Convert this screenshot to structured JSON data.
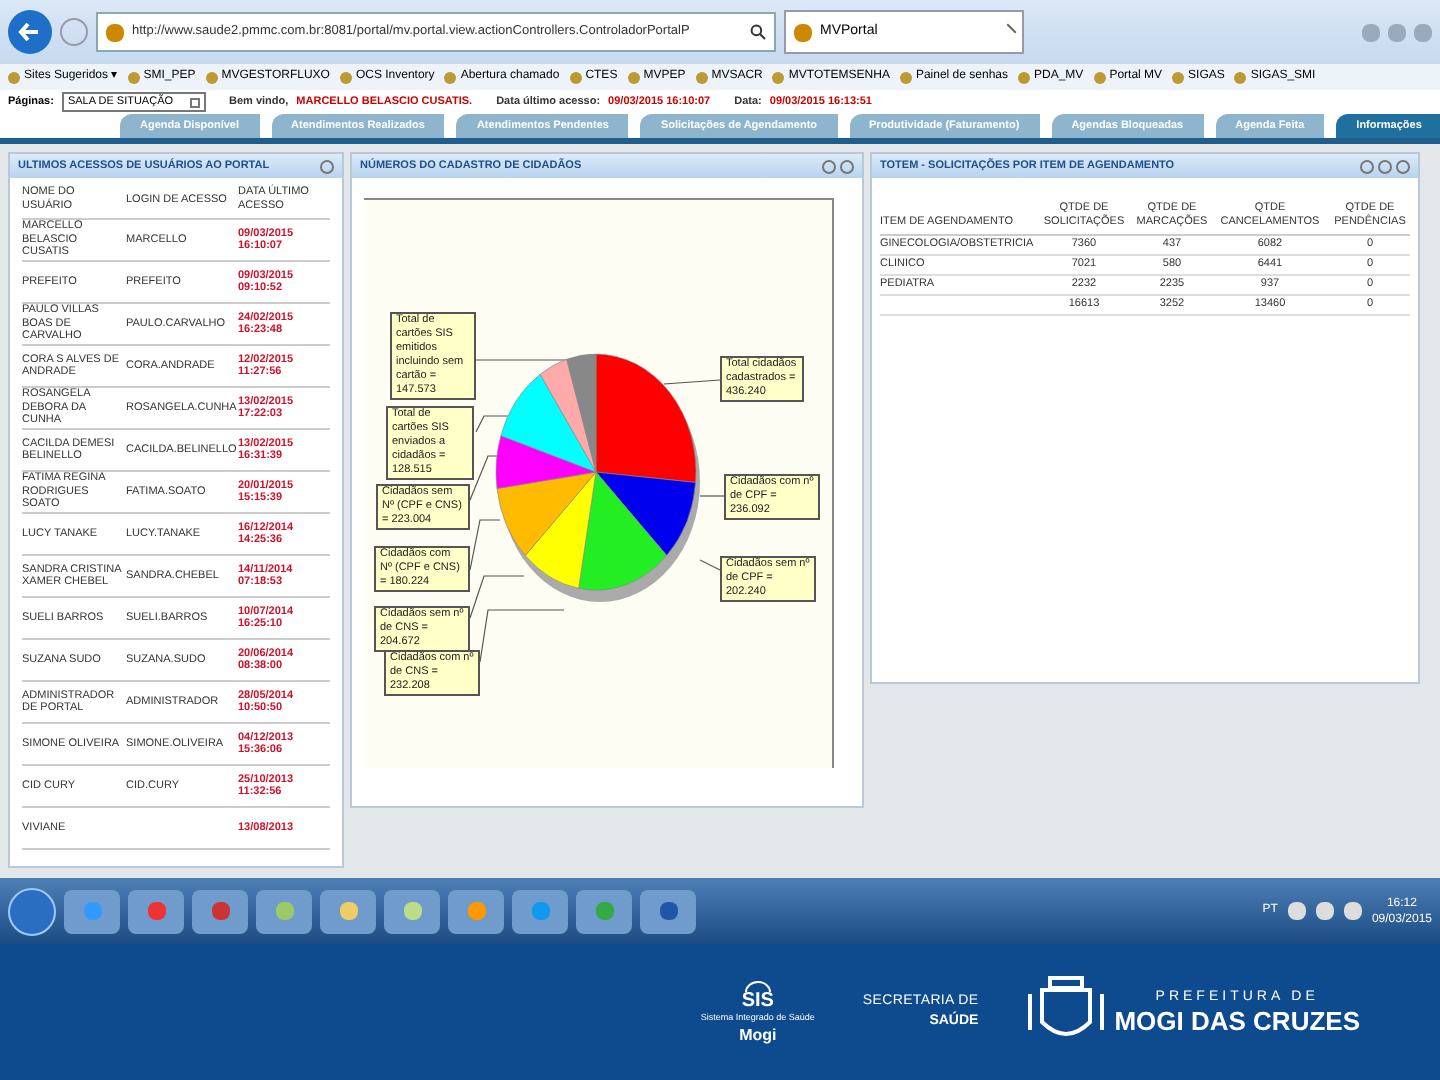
{
  "browser": {
    "address": "http://www.saude2.pmmc.com.br:8081/portal/mv.portal.view.actionControllers.ControladorPortalP",
    "tab_title": "MVPortal",
    "favorites": [
      "Sites Sugeridos ▾",
      "SMI_PEP",
      "MVGESTORFLUXO",
      "OCS Inventory",
      "Abertura chamado",
      "CTES",
      "MVPEP",
      "MVSACR",
      "MVTOTEMSENHA",
      "Painel de senhas",
      "PDA_MV",
      "Portal MV",
      "SIGAS",
      "SIGAS_SMI"
    ]
  },
  "header": {
    "pages_label": "Páginas:",
    "page_select": "SALA DE SITUAÇÃO",
    "welcome_label": "Bem vindo,",
    "user": "MARCELLO BELASCIO CUSATIS.",
    "last_access_label": "Data último acesso:",
    "last_access": "09/03/2015 16:10:07",
    "date_label": "Data:",
    "date": "09/03/2015 16:13:51"
  },
  "tabs": [
    {
      "label": "Agenda Disponível",
      "selected": false
    },
    {
      "label": "Atendimentos Realizados",
      "selected": false
    },
    {
      "label": "Atendimentos Pendentes",
      "selected": false
    },
    {
      "label": "Solicitações de Agendamento",
      "selected": false
    },
    {
      "label": "Produtividade (Faturamento)",
      "selected": false
    },
    {
      "label": "Agendas Bloqueadas",
      "selected": false
    },
    {
      "label": "Agenda Feita",
      "selected": false
    },
    {
      "label": "Informações",
      "selected": true
    }
  ],
  "access_panel": {
    "title": "ULTIMOS ACESSOS DE USUÁRIOS AO PORTAL",
    "columns": [
      "NOME DO USUÁRIO",
      "LOGIN DE ACESSO",
      "DATA ÚLTIMO ACESSO"
    ],
    "rows": [
      [
        "MARCELLO BELASCIO CUSATIS",
        "MARCELLO",
        "09/03/2015 16:10:07"
      ],
      [
        "PREFEITO",
        "PREFEITO",
        "09/03/2015 09:10:52"
      ],
      [
        "PAULO VILLAS BOAS DE CARVALHO",
        "PAULO.CARVALHO",
        "24/02/2015 16:23:48"
      ],
      [
        "CORA S ALVES DE ANDRADE",
        "CORA.ANDRADE",
        "12/02/2015 11:27:56"
      ],
      [
        "ROSANGELA DEBORA DA CUNHA",
        "ROSANGELA.CUNHA",
        "13/02/2015 17:22:03"
      ],
      [
        "CACILDA DEMESI BELINELLO",
        "CACILDA.BELINELLO",
        "13/02/2015 16:31:39"
      ],
      [
        "FATIMA REGINA RODRIGUES SOATO",
        "FATIMA.SOATO",
        "20/01/2015 15:15:39"
      ],
      [
        "LUCY TANAKE",
        "LUCY.TANAKE",
        "16/12/2014 14:25:36"
      ],
      [
        "SANDRA CRISTINA XAMER CHEBEL",
        "SANDRA.CHEBEL",
        "14/11/2014 07:18:53"
      ],
      [
        "SUELI BARROS",
        "SUELI.BARROS",
        "10/07/2014 16:25:10"
      ],
      [
        "SUZANA SUDO",
        "SUZANA.SUDO",
        "20/06/2014 08:38:00"
      ],
      [
        "ADMINISTRADOR DE PORTAL",
        "ADMINISTRADOR",
        "28/05/2014 10:50:50"
      ],
      [
        "SIMONE OLIVEIRA",
        "SIMONE.OLIVEIRA",
        "04/12/2013 15:36:06"
      ],
      [
        "CID CURY",
        "CID.CURY",
        "25/10/2013 11:32:56"
      ],
      [
        "VIVIANE",
        "",
        "13/08/2013"
      ]
    ]
  },
  "citizens_panel": {
    "title": "NÚMEROS DO CADASTRO DE CIDADÃOS",
    "callouts": [
      "Total de cartões SIS emitidos incluindo sem cartão = 147.573",
      "Total de cartões SIS enviados a cidadãos = 128.515",
      "Cidadãos sem Nº (CPF e CNS) = 223.004",
      "Cidadãos com Nº (CPF e CNS) = 180.224",
      "Cidadãos sem nº de CNS = 204.672",
      "Cidadãos com nº de CNS = 232.208",
      "Total cidadãos cadastrados = 436.240",
      "Cidadãos com nº de CPF = 236.092",
      "Cidadãos sem nº de CPF = 202.240"
    ]
  },
  "totem_panel": {
    "title": "TOTEM - SOLICITAÇÕES POR ITEM DE AGENDAMENTO",
    "columns": [
      "ITEM DE AGENDAMENTO",
      "QTDE DE SOLICITAÇÕES",
      "QTDE DE MARCAÇÕES",
      "QTDE CANCELAMENTOS",
      "QTDE DE PENDÊNCIAS"
    ],
    "rows": [
      [
        "GINECOLOGIA/OBSTETRICIA",
        "7360",
        "437",
        "6082",
        "0"
      ],
      [
        "CLINICO",
        "7021",
        "580",
        "6441",
        "0"
      ],
      [
        "PEDIATRA",
        "2232",
        "2235",
        "937",
        "0"
      ],
      [
        "",
        "16613",
        "3252",
        "13460",
        "0"
      ]
    ]
  },
  "taskbar": {
    "language": "PT",
    "time": "16:12",
    "date": "09/03/2015"
  },
  "footer": {
    "sis": "SIS",
    "sis_caption": "Sistema Integrado de Saúde",
    "sis_city": "Mogi",
    "secretaria_line1": "SECRETARIA DE",
    "secretaria_line2": "SAÚDE",
    "prefeitura_line1": "PREFEITURA DE",
    "prefeitura_line2": "MOGI DAS CRUZES"
  }
}
